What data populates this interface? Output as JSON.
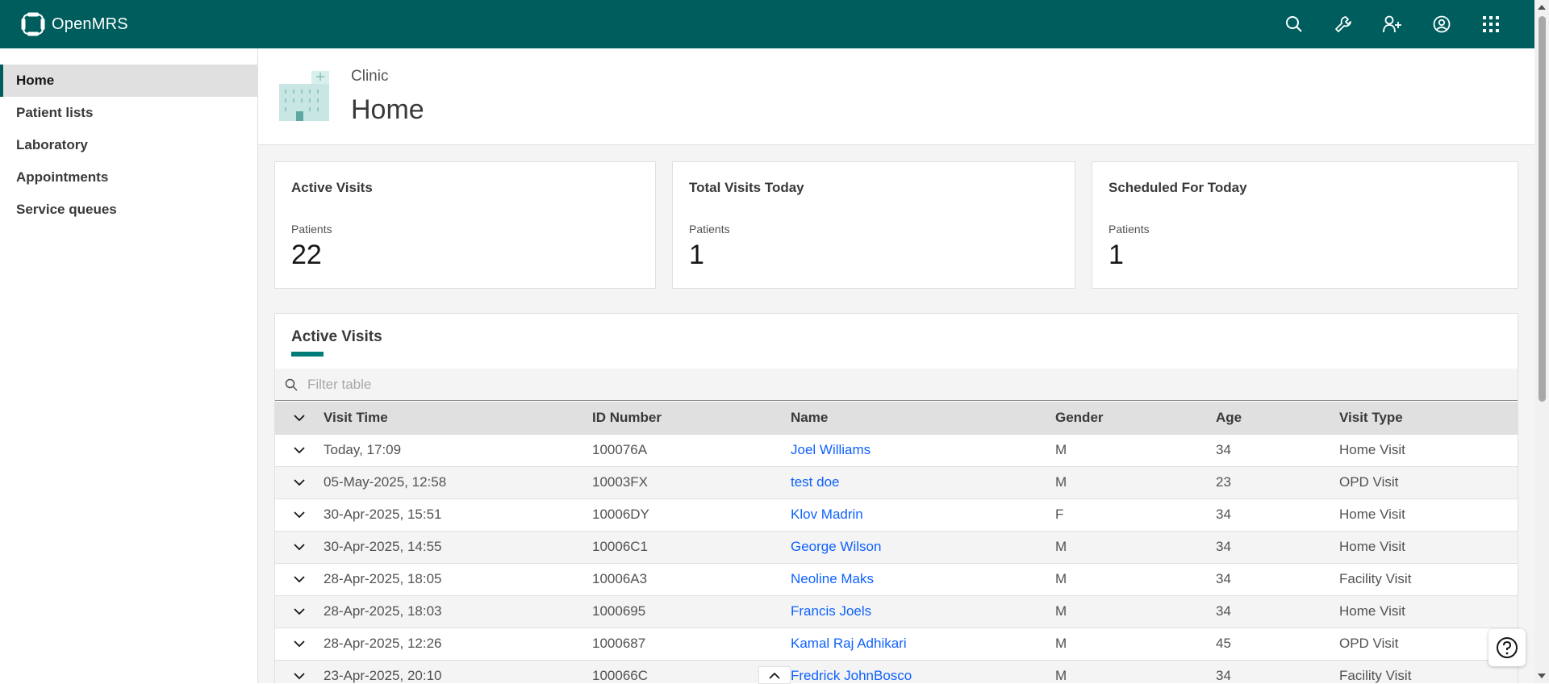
{
  "app": {
    "brand": "OpenMRS"
  },
  "topbar": {
    "icons": [
      "search-icon",
      "wrench-icon",
      "add-patient-icon",
      "user-avatar-icon",
      "app-switcher-icon"
    ]
  },
  "sidebar": {
    "items": [
      {
        "label": "Home",
        "active": true
      },
      {
        "label": "Patient lists",
        "active": false
      },
      {
        "label": "Laboratory",
        "active": false
      },
      {
        "label": "Appointments",
        "active": false
      },
      {
        "label": "Service queues",
        "active": false
      }
    ]
  },
  "header": {
    "subtitle": "Clinic",
    "title": "Home"
  },
  "tiles": [
    {
      "title": "Active Visits",
      "label": "Patients",
      "value": "22"
    },
    {
      "title": "Total Visits Today",
      "label": "Patients",
      "value": "1"
    },
    {
      "title": "Scheduled For Today",
      "label": "Patients",
      "value": "1"
    }
  ],
  "active_visits": {
    "title": "Active Visits",
    "filter_placeholder": "Filter table",
    "columns": [
      "Visit Time",
      "ID Number",
      "Name",
      "Gender",
      "Age",
      "Visit Type"
    ],
    "rows": [
      {
        "visit_time": "Today, 17:09",
        "id": "100076A",
        "name": "Joel Williams",
        "gender": "M",
        "age": "34",
        "visit_type": "Home Visit"
      },
      {
        "visit_time": "05-May-2025, 12:58",
        "id": "10003FX",
        "name": "test doe",
        "gender": "M",
        "age": "23",
        "visit_type": "OPD Visit"
      },
      {
        "visit_time": "30-Apr-2025, 15:51",
        "id": "10006DY",
        "name": "Klov Madrin",
        "gender": "F",
        "age": "34",
        "visit_type": "Home Visit"
      },
      {
        "visit_time": "30-Apr-2025, 14:55",
        "id": "10006C1",
        "name": "George Wilson",
        "gender": "M",
        "age": "34",
        "visit_type": "Home Visit"
      },
      {
        "visit_time": "28-Apr-2025, 18:05",
        "id": "10006A3",
        "name": "Neoline Maks",
        "gender": "M",
        "age": "34",
        "visit_type": "Facility Visit"
      },
      {
        "visit_time": "28-Apr-2025, 18:03",
        "id": "1000695",
        "name": "Francis Joels",
        "gender": "M",
        "age": "34",
        "visit_type": "Home Visit"
      },
      {
        "visit_time": "28-Apr-2025, 12:26",
        "id": "1000687",
        "name": "Kamal Raj Adhikari",
        "gender": "M",
        "age": "45",
        "visit_type": "OPD Visit"
      },
      {
        "visit_time": "23-Apr-2025, 20:10",
        "id": "100066C",
        "name": "Fredrick JohnBosco",
        "gender": "M",
        "age": "34",
        "visit_type": "Facility Visit"
      }
    ]
  },
  "colors": {
    "brand": "#005d5d",
    "accent": "#007d79",
    "link": "#0f62fe"
  }
}
